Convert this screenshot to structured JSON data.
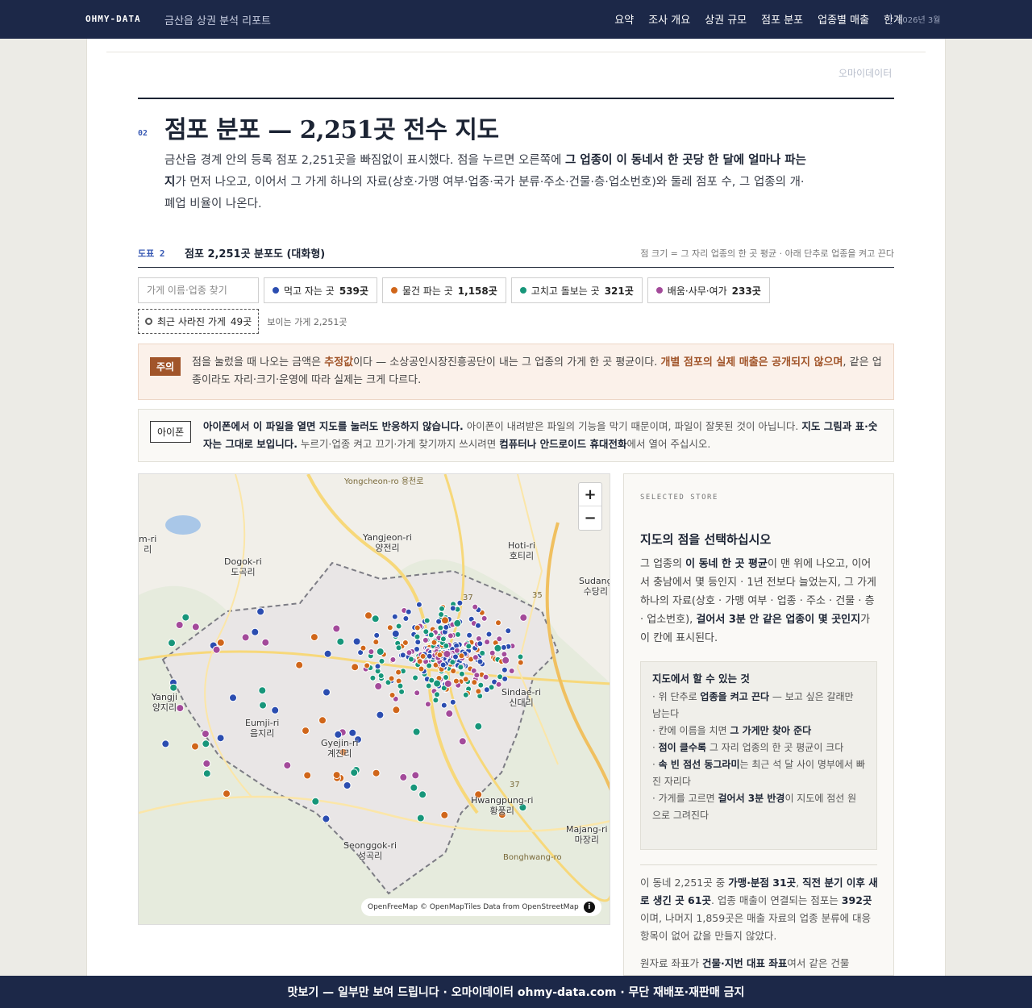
{
  "nav": {
    "brand": "OHMY-DATA",
    "report_title": "금산읍 상권 분석 리포트",
    "links": [
      "요약",
      "조사 개요",
      "상권 규모",
      "점포 분포",
      "업종별 매출",
      "한계"
    ],
    "date": "2026년 3월"
  },
  "corner_mark": "오마이데이터",
  "section": {
    "number": "02",
    "title": "점포 분포 — 2,251곳 전수 지도",
    "lead_1": "금산읍 경계 안의 등록 점포 2,251곳을 빠짐없이 표시했다. 점을 누르면 오른쪽에 ",
    "lead_bold": "그 업종이 이 동네서 한 곳당 한 달에 얼마나 파는지",
    "lead_2": "가 먼저 나오고, 이어서 그 가게 하나의 자료(상호·가맹 여부·업종·국가 분류·주소·건물·층·업소번호)와 둘레 점포 수, 그 업종의 개·폐업 비율이 나온다."
  },
  "figure": {
    "number": "도표 2",
    "title": "점포 2,251곳 분포도 (대화형)",
    "note": "점 크기 = 그 자리 업종의 한 곳 평균 · 아래 단추로 업종을 켜고 끈다"
  },
  "controls": {
    "search_placeholder": "가게 이름·업종 찾기",
    "chips": [
      {
        "label": "먹고 자는 곳",
        "count": "539곳",
        "color": "#2b4db0"
      },
      {
        "label": "물건 파는 곳",
        "count": "1,158곳",
        "color": "#d0661a"
      },
      {
        "label": "고치고 돌보는 곳",
        "count": "321곳",
        "color": "#17967a"
      },
      {
        "label": "배움·사무·여가",
        "count": "233곳",
        "color": "#a34a9a"
      }
    ],
    "closed_label": "최근 사라진 가게",
    "closed_count": "49곳",
    "visible": "보이는 가게 2,251곳"
  },
  "notice_warn": {
    "tag": "주의",
    "t1": "점을 눌렀을 때 나오는 금액은 ",
    "h1": "추정값",
    "t2": "이다 — 소상공인시장진흥공단이 내는 그 업종의 가게 한 곳 평균이다. ",
    "h2": "개별 점포의 실제 매출은 공개되지 않으며",
    "t3": ", 같은 업종이라도 자리·크기·운영에 따라 실제는 크게 다르다."
  },
  "notice_ios": {
    "tag": "아이폰",
    "b1": "아이폰에서 이 파일을 열면 지도를 눌러도 반응하지 않습니다.",
    "t1": " 아이폰이 내려받은 파일의 기능을 막기 때문이며, 파일이 잘못된 것이 아닙니다. ",
    "b2": "지도 그림과 표·숫자는 그대로 보입니다.",
    "t2": " 누르기·업종 켜고 끄기·가게 찾기까지 쓰시려면 ",
    "b3": "컴퓨터나 안드로이드 휴대전화",
    "t3": "에서 열어 주십시오."
  },
  "map": {
    "places": [
      {
        "ko": "양전리",
        "en": "Yangjeon-ri"
      },
      {
        "ko": "호티리",
        "en": "Hoti-ri"
      },
      {
        "ko": "도곡리",
        "en": "Dogok-ri"
      },
      {
        "ko": "수당리",
        "en": "Sudang"
      },
      {
        "ko": "양지리",
        "en": "Yangji"
      },
      {
        "ko": "음지리",
        "en": "Eumji-ri"
      },
      {
        "ko": "계진리",
        "en": "Gyejin-ri"
      },
      {
        "ko": "신대리",
        "en": "Sindae-ri"
      },
      {
        "ko": "황풍리",
        "en": "Hwangpung-ri"
      },
      {
        "ko": "마장리",
        "en": "Majang-ri"
      },
      {
        "ko": "성곡리",
        "en": "Seonggok-ri"
      },
      {
        "ko": "리",
        "en": "m-ri"
      }
    ],
    "roads": [
      "Yongcheon-ro 용천로",
      "37",
      "35",
      "37",
      "Bonghwang-ro"
    ],
    "zoom_in": "+",
    "zoom_out": "−",
    "attribution": "OpenFreeMap © OpenMapTiles Data from OpenStreetMap",
    "info": "i"
  },
  "panel": {
    "kicker": "SELECTED STORE",
    "title": "지도의 점을 선택하십시오",
    "d1": "그 업종의 ",
    "d1b": "이 동네 한 곳 평균",
    "d2": "이 맨 위에 나오고, 이어서 충남에서 몇 등인지 · 1년 전보다 늘었는지, 그 가게 하나의 자료(상호 · 가맹 여부 · 업종 · 주소 · 건물 · 층 · 업소번호), ",
    "d2b": "걸어서 3분 안 같은 업종이 몇 곳인지",
    "d3": "가 이 칸에 표시된다.",
    "box_title": "지도에서 할 수 있는 것",
    "box_items": [
      {
        "pre": "· 위 단추로 ",
        "b": "업종을 켜고 끈다",
        "post": " — 보고 싶은 갈래만 남는다"
      },
      {
        "pre": "· 칸에 이름을 치면 ",
        "b": "그 가게만 찾아 준다",
        "post": ""
      },
      {
        "pre": "· ",
        "b": "점이 클수록",
        "post": " 그 자리 업종의 한 곳 평균이 크다"
      },
      {
        "pre": "· ",
        "b": "속 빈 점선 동그라미",
        "post": "는 최근 석 달 사이 명부에서 빠진 자리다"
      },
      {
        "pre": "· 가게를 고르면 ",
        "b": "걸어서 3분 반경",
        "post": "이 지도에 점선 원으로 그려진다"
      }
    ],
    "s1": "이 동네 2,251곳 중 ",
    "s1b": "가맹·분점 31곳",
    "s2": ", ",
    "s2b": "직전 분기 이후 새로 생긴 곳 61곳",
    "s3": ". 업종 매출이 연결되는 점포는 ",
    "s3b": "392곳",
    "s4": "이며, 나머지 1,859곳은 매출 자료의 업종 분류에 대응 항목이 없어 값을 만들지 않았다.",
    "src1": "원자료 좌표가 ",
    "src1b": "건물·지번 대표 좌표",
    "src2": "여서 같은 건물"
  },
  "banner": "맛보기 — 일부만 보여 드립니다 · 오마이데이터 ohmy-data.com · 무단 재배포·재판매 금지"
}
